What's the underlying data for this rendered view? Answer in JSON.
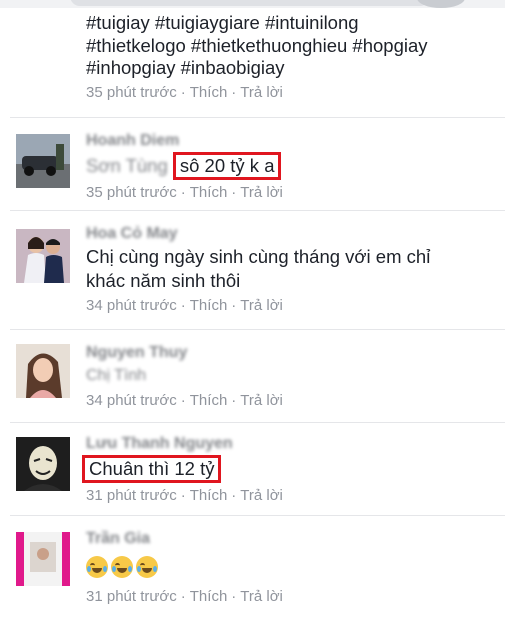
{
  "colors": {
    "meta": "#90949c",
    "highlight": "#e0161f",
    "separator": "#e5e6e9"
  },
  "post": {
    "hashtag_lines": [
      "#tuigiay #tuigiaygiare #intuinilong",
      "#thietkelogo  #thietkethuonghieu #hopgiay",
      "#inhopgiay #inbaobigiay"
    ],
    "meta": {
      "time": "35 phút trước",
      "like": "Thích",
      "reply": "Trả lời"
    }
  },
  "comments": [
    {
      "name": "Hoanh Diem",
      "mention": "Sơn Tùng",
      "text": "sô 20 tỷ k a",
      "avatar_icon": "car-photo-avatar",
      "meta": {
        "time": "35 phút trước",
        "like": "Thích",
        "reply": "Trả lời"
      }
    },
    {
      "name": "Hoa Cỏ May",
      "text": "Chị cùng ngày sinh cùng tháng với em chỉ khác năm sinh thôi",
      "avatar_icon": "couple-photo-avatar",
      "meta": {
        "time": "34 phút trước",
        "like": "Thích",
        "reply": "Trả lời"
      }
    },
    {
      "name": "Nguyen Thuy",
      "text": "Chị Tình",
      "avatar_icon": "woman-photo-avatar",
      "meta": {
        "time": "34 phút trước",
        "like": "Thích",
        "reply": "Trả lời"
      }
    },
    {
      "name": "Lưu Thanh Nguyen",
      "text": "Chuân thì 12 tỷ",
      "avatar_icon": "mask-photo-avatar",
      "meta": {
        "time": "31 phút trước",
        "like": "Thích",
        "reply": "Trả lời"
      }
    },
    {
      "name": "Trần Gia",
      "emoji_icons": [
        "tears-of-joy-emoji",
        "tears-of-joy-emoji",
        "tears-of-joy-emoji"
      ],
      "avatar_icon": "pink-photo-avatar",
      "meta": {
        "time": "31 phút trước",
        "like": "Thích",
        "reply": "Trả lời"
      }
    }
  ]
}
